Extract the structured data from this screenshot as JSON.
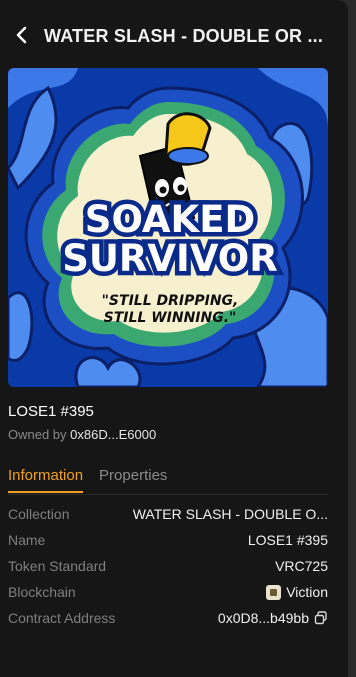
{
  "header": {
    "title": "WATER SLASH - DOUBLE OR ...",
    "back_icon": "chevron-left-icon"
  },
  "artwork": {
    "headline_line1": "SOAKED",
    "headline_line2": "SURVIVOR",
    "quote_line1": "\"STILL DRIPPING,",
    "quote_line2": "STILL WINNING.\"",
    "background_color": "#0a3aa8",
    "accent_color": "#f5c81a"
  },
  "nft": {
    "name": "LOSE1 #395",
    "owned_by_label": "Owned by",
    "owner_address": "0x86D...E6000"
  },
  "tabs": [
    {
      "label": "Information",
      "active": true
    },
    {
      "label": "Properties",
      "active": false
    }
  ],
  "details": {
    "collection_label": "Collection",
    "collection_value": "WATER SLASH - DOUBLE O...",
    "name_label": "Name",
    "name_value": "LOSE1 #395",
    "standard_label": "Token Standard",
    "standard_value": "VRC725",
    "blockchain_label": "Blockchain",
    "blockchain_value": "Viction",
    "contract_label": "Contract Address",
    "contract_value": "0x0D8...b49bb"
  },
  "colors": {
    "accent": "#f0a020",
    "background": "#161616"
  }
}
